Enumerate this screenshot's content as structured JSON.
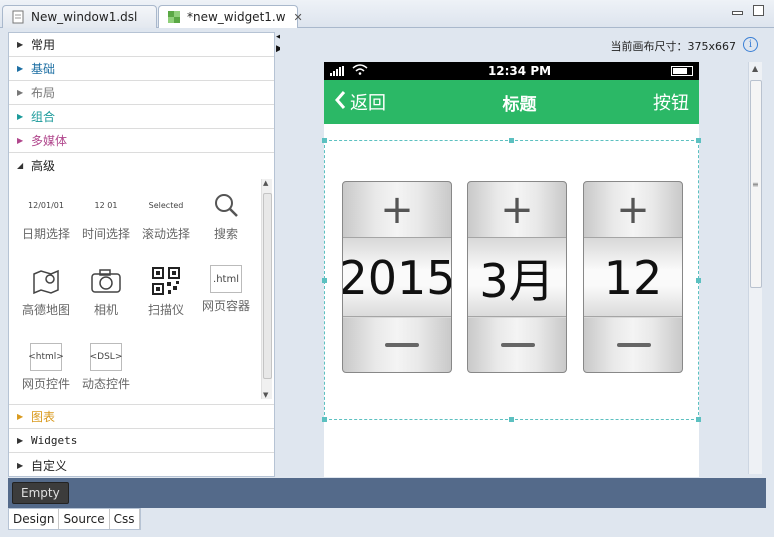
{
  "tabs": [
    {
      "label": "New_window1.dsl",
      "active": false
    },
    {
      "label": "*new_widget1.w",
      "active": true
    }
  ],
  "palette": {
    "categories_top": [
      {
        "label": "常用",
        "color": "dark"
      },
      {
        "label": "基础",
        "color": "blue"
      },
      {
        "label": "布局",
        "color": "gray"
      },
      {
        "label": "组合",
        "color": "teal"
      },
      {
        "label": "多媒体",
        "color": "pink"
      },
      {
        "label": "高级",
        "color": "dark",
        "expanded": true
      }
    ],
    "advanced_items": [
      {
        "label": "日期选择",
        "icon": "date-picker-icon",
        "icon_text": "12/01/01"
      },
      {
        "label": "时间选择",
        "icon": "time-picker-icon",
        "icon_text": "12 01"
      },
      {
        "label": "滚动选择",
        "icon": "scroll-picker-icon",
        "icon_text": "Selected"
      },
      {
        "label": "搜索",
        "icon": "search-icon"
      },
      {
        "label": "高德地图",
        "icon": "map-icon"
      },
      {
        "label": "相机",
        "icon": "camera-icon"
      },
      {
        "label": "扫描仪",
        "icon": "qr-code-icon"
      },
      {
        "label": "网页容器",
        "icon": "html-icon",
        "icon_text": ".html"
      },
      {
        "label": "网页控件",
        "icon": "html-control-icon",
        "icon_text": "<html>"
      },
      {
        "label": "动态控件",
        "icon": "dsl-icon",
        "icon_text": "<DSL>"
      }
    ],
    "categories_bottom": [
      {
        "label": "图表",
        "color": "orange"
      },
      {
        "label": "Widgets",
        "color": "mono"
      },
      {
        "label": "自定义",
        "color": "dark"
      }
    ]
  },
  "canvas": {
    "size_label": "当前画布尺寸：375x667"
  },
  "phone": {
    "time": "12:34 PM",
    "nav": {
      "back": "返回",
      "title": "标题",
      "button": "按钮"
    },
    "picker": {
      "plus": "+",
      "columns": [
        {
          "value": "2015"
        },
        {
          "value": "3月"
        },
        {
          "value": "12"
        }
      ]
    },
    "colors": {
      "navbar": "#2bb866",
      "selection": "#5cc0c0"
    }
  },
  "bottom": {
    "empty_label": "Empty",
    "modes": [
      "Design",
      "Source",
      "Css"
    ]
  }
}
